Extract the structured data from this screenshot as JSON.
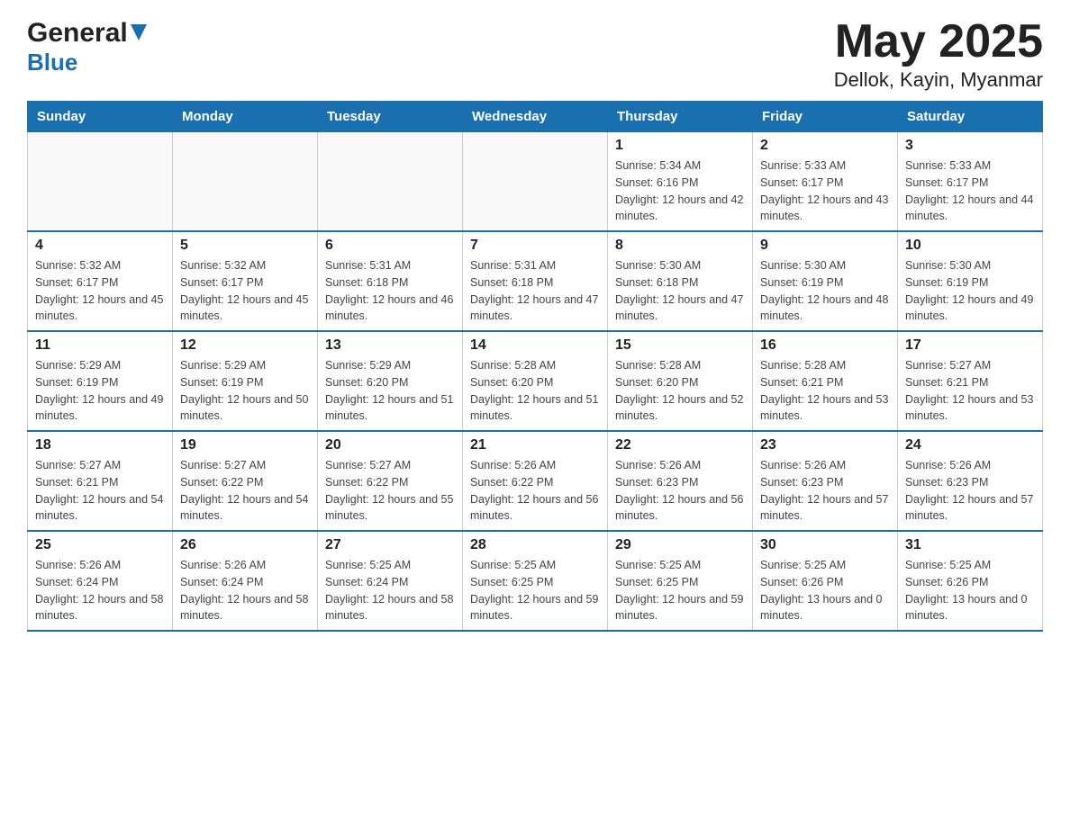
{
  "header": {
    "logo_main": "General",
    "logo_arrow_color": "#1a6faf",
    "logo_sub": "Blue",
    "title": "May 2025",
    "subtitle": "Dellok, Kayin, Myanmar"
  },
  "days_of_week": [
    "Sunday",
    "Monday",
    "Tuesday",
    "Wednesday",
    "Thursday",
    "Friday",
    "Saturday"
  ],
  "weeks": [
    [
      {
        "day": "",
        "sunrise": "",
        "sunset": "",
        "daylight": ""
      },
      {
        "day": "",
        "sunrise": "",
        "sunset": "",
        "daylight": ""
      },
      {
        "day": "",
        "sunrise": "",
        "sunset": "",
        "daylight": ""
      },
      {
        "day": "",
        "sunrise": "",
        "sunset": "",
        "daylight": ""
      },
      {
        "day": "1",
        "sunrise": "Sunrise: 5:34 AM",
        "sunset": "Sunset: 6:16 PM",
        "daylight": "Daylight: 12 hours and 42 minutes."
      },
      {
        "day": "2",
        "sunrise": "Sunrise: 5:33 AM",
        "sunset": "Sunset: 6:17 PM",
        "daylight": "Daylight: 12 hours and 43 minutes."
      },
      {
        "day": "3",
        "sunrise": "Sunrise: 5:33 AM",
        "sunset": "Sunset: 6:17 PM",
        "daylight": "Daylight: 12 hours and 44 minutes."
      }
    ],
    [
      {
        "day": "4",
        "sunrise": "Sunrise: 5:32 AM",
        "sunset": "Sunset: 6:17 PM",
        "daylight": "Daylight: 12 hours and 45 minutes."
      },
      {
        "day": "5",
        "sunrise": "Sunrise: 5:32 AM",
        "sunset": "Sunset: 6:17 PM",
        "daylight": "Daylight: 12 hours and 45 minutes."
      },
      {
        "day": "6",
        "sunrise": "Sunrise: 5:31 AM",
        "sunset": "Sunset: 6:18 PM",
        "daylight": "Daylight: 12 hours and 46 minutes."
      },
      {
        "day": "7",
        "sunrise": "Sunrise: 5:31 AM",
        "sunset": "Sunset: 6:18 PM",
        "daylight": "Daylight: 12 hours and 47 minutes."
      },
      {
        "day": "8",
        "sunrise": "Sunrise: 5:30 AM",
        "sunset": "Sunset: 6:18 PM",
        "daylight": "Daylight: 12 hours and 47 minutes."
      },
      {
        "day": "9",
        "sunrise": "Sunrise: 5:30 AM",
        "sunset": "Sunset: 6:19 PM",
        "daylight": "Daylight: 12 hours and 48 minutes."
      },
      {
        "day": "10",
        "sunrise": "Sunrise: 5:30 AM",
        "sunset": "Sunset: 6:19 PM",
        "daylight": "Daylight: 12 hours and 49 minutes."
      }
    ],
    [
      {
        "day": "11",
        "sunrise": "Sunrise: 5:29 AM",
        "sunset": "Sunset: 6:19 PM",
        "daylight": "Daylight: 12 hours and 49 minutes."
      },
      {
        "day": "12",
        "sunrise": "Sunrise: 5:29 AM",
        "sunset": "Sunset: 6:19 PM",
        "daylight": "Daylight: 12 hours and 50 minutes."
      },
      {
        "day": "13",
        "sunrise": "Sunrise: 5:29 AM",
        "sunset": "Sunset: 6:20 PM",
        "daylight": "Daylight: 12 hours and 51 minutes."
      },
      {
        "day": "14",
        "sunrise": "Sunrise: 5:28 AM",
        "sunset": "Sunset: 6:20 PM",
        "daylight": "Daylight: 12 hours and 51 minutes."
      },
      {
        "day": "15",
        "sunrise": "Sunrise: 5:28 AM",
        "sunset": "Sunset: 6:20 PM",
        "daylight": "Daylight: 12 hours and 52 minutes."
      },
      {
        "day": "16",
        "sunrise": "Sunrise: 5:28 AM",
        "sunset": "Sunset: 6:21 PM",
        "daylight": "Daylight: 12 hours and 53 minutes."
      },
      {
        "day": "17",
        "sunrise": "Sunrise: 5:27 AM",
        "sunset": "Sunset: 6:21 PM",
        "daylight": "Daylight: 12 hours and 53 minutes."
      }
    ],
    [
      {
        "day": "18",
        "sunrise": "Sunrise: 5:27 AM",
        "sunset": "Sunset: 6:21 PM",
        "daylight": "Daylight: 12 hours and 54 minutes."
      },
      {
        "day": "19",
        "sunrise": "Sunrise: 5:27 AM",
        "sunset": "Sunset: 6:22 PM",
        "daylight": "Daylight: 12 hours and 54 minutes."
      },
      {
        "day": "20",
        "sunrise": "Sunrise: 5:27 AM",
        "sunset": "Sunset: 6:22 PM",
        "daylight": "Daylight: 12 hours and 55 minutes."
      },
      {
        "day": "21",
        "sunrise": "Sunrise: 5:26 AM",
        "sunset": "Sunset: 6:22 PM",
        "daylight": "Daylight: 12 hours and 56 minutes."
      },
      {
        "day": "22",
        "sunrise": "Sunrise: 5:26 AM",
        "sunset": "Sunset: 6:23 PM",
        "daylight": "Daylight: 12 hours and 56 minutes."
      },
      {
        "day": "23",
        "sunrise": "Sunrise: 5:26 AM",
        "sunset": "Sunset: 6:23 PM",
        "daylight": "Daylight: 12 hours and 57 minutes."
      },
      {
        "day": "24",
        "sunrise": "Sunrise: 5:26 AM",
        "sunset": "Sunset: 6:23 PM",
        "daylight": "Daylight: 12 hours and 57 minutes."
      }
    ],
    [
      {
        "day": "25",
        "sunrise": "Sunrise: 5:26 AM",
        "sunset": "Sunset: 6:24 PM",
        "daylight": "Daylight: 12 hours and 58 minutes."
      },
      {
        "day": "26",
        "sunrise": "Sunrise: 5:26 AM",
        "sunset": "Sunset: 6:24 PM",
        "daylight": "Daylight: 12 hours and 58 minutes."
      },
      {
        "day": "27",
        "sunrise": "Sunrise: 5:25 AM",
        "sunset": "Sunset: 6:24 PM",
        "daylight": "Daylight: 12 hours and 58 minutes."
      },
      {
        "day": "28",
        "sunrise": "Sunrise: 5:25 AM",
        "sunset": "Sunset: 6:25 PM",
        "daylight": "Daylight: 12 hours and 59 minutes."
      },
      {
        "day": "29",
        "sunrise": "Sunrise: 5:25 AM",
        "sunset": "Sunset: 6:25 PM",
        "daylight": "Daylight: 12 hours and 59 minutes."
      },
      {
        "day": "30",
        "sunrise": "Sunrise: 5:25 AM",
        "sunset": "Sunset: 6:26 PM",
        "daylight": "Daylight: 13 hours and 0 minutes."
      },
      {
        "day": "31",
        "sunrise": "Sunrise: 5:25 AM",
        "sunset": "Sunset: 6:26 PM",
        "daylight": "Daylight: 13 hours and 0 minutes."
      }
    ]
  ]
}
